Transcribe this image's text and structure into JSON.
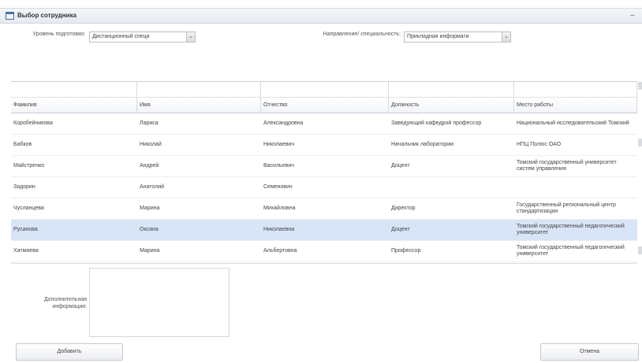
{
  "window": {
    "title": "Выбор сотрудника",
    "minimize": "–"
  },
  "filters": {
    "level_label": "Уровень подготовки:",
    "level_value": "Дистанционный специ",
    "direction_label": "Направление/ специальность:",
    "direction_value": "Прикладная информати",
    "dropdown_glyph": "⌄"
  },
  "table": {
    "columns": [
      "Фамилия",
      "Имя",
      "Отчество",
      "Должность",
      "Место работы"
    ],
    "rows": [
      [
        "Коробейникова",
        "Лариса",
        "Александровна",
        "Заведующий кафедрой профессор",
        "Национальный исследовательский Томский"
      ],
      [
        "Бабков",
        "Николай",
        "Николаевич",
        "Начальник лаборатории",
        "НПЦ Полюс ОАО"
      ],
      [
        "Майстренко",
        "Андрей",
        "Васильевич",
        "Доцент",
        "Томский государственный университет систем управления"
      ],
      [
        "Задорин",
        "Анатолий",
        "Семенович",
        "",
        ""
      ],
      [
        "Чусланцева",
        "Марина",
        "Михайловна",
        "Директор",
        "Государственный региональный центр стандартизации"
      ],
      [
        "Русанова",
        "Оксана",
        "Николаевна",
        "Доцент",
        "Томский государственный педагогический университет"
      ],
      [
        "Хатмаева",
        "Марина",
        "Альбертовна",
        "Профессор",
        "Томский государственный педагогический университет"
      ]
    ],
    "selected_row": 5
  },
  "extra": {
    "label": "Дополнительная информация:"
  },
  "buttons": {
    "add": "Добавить",
    "cancel": "Отмена"
  }
}
